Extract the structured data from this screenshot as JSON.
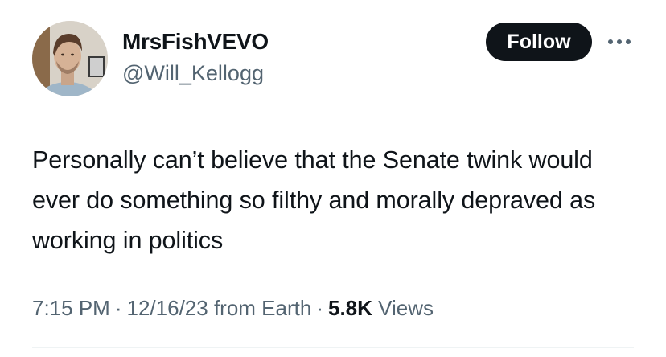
{
  "author": {
    "display_name": "MrsFishVEVO",
    "handle": "@Will_Kellogg"
  },
  "actions": {
    "follow_label": "Follow",
    "more_icon": "more-horizontal-icon"
  },
  "tweet": {
    "text": "Personally can’t believe that the Senate twink would ever do something so filthy and morally depraved as working in politics"
  },
  "meta": {
    "time": "7:15 PM",
    "date": "12/16/23",
    "source": "from Earth",
    "views_count": "5.8K",
    "views_label": "Views",
    "separator": "·"
  },
  "colors": {
    "text_primary": "#0f1419",
    "text_secondary": "#536471",
    "button_bg": "#0f1419",
    "divider": "#eff3f4"
  }
}
